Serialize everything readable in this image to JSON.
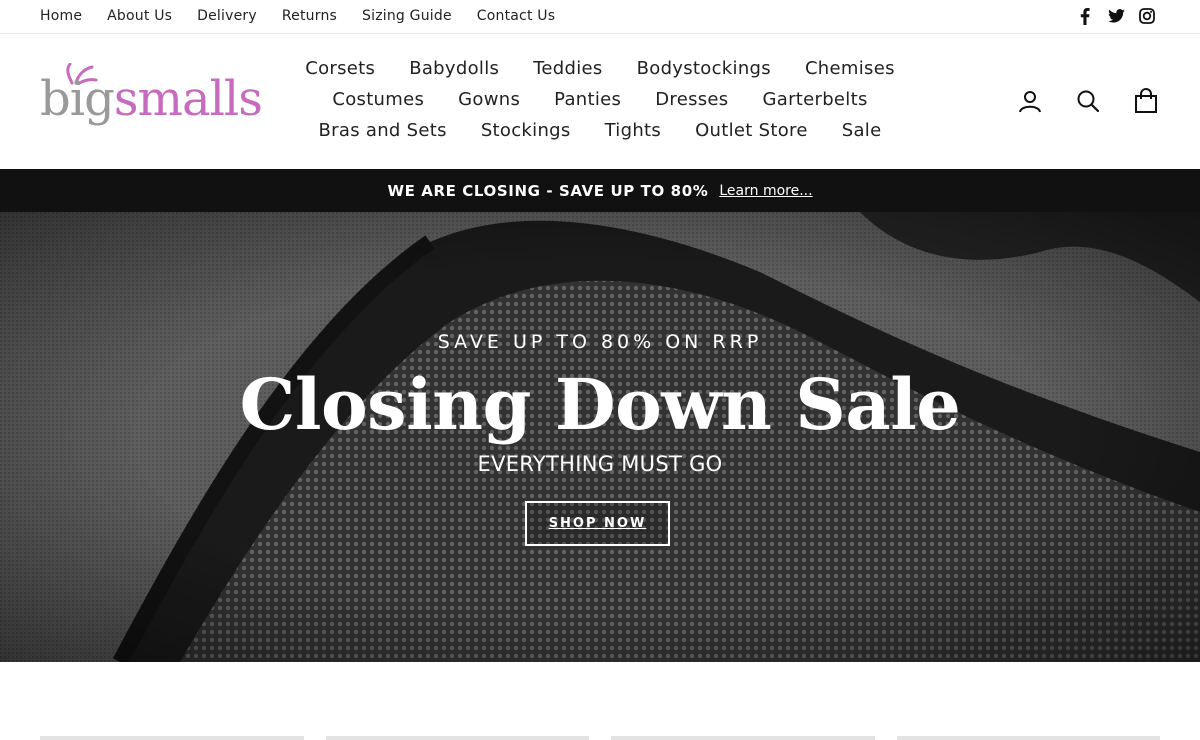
{
  "utility_nav": {
    "links": [
      "Home",
      "About Us",
      "Delivery",
      "Returns",
      "Sizing Guide",
      "Contact Us"
    ],
    "social_icons": [
      "facebook-icon",
      "twitter-icon",
      "instagram-icon"
    ]
  },
  "logo": {
    "part1": "big",
    "part2": "smalls",
    "accent_color": "#c76bbf",
    "base_color": "#9a9a9a"
  },
  "main_nav": {
    "items": [
      "Corsets",
      "Babydolls",
      "Teddies",
      "Bodystockings",
      "Chemises",
      "Costumes",
      "Gowns",
      "Panties",
      "Dresses",
      "Garterbelts",
      "Bras and Sets",
      "Stockings",
      "Tights",
      "Outlet Store",
      "Sale"
    ]
  },
  "header_icons": [
    "account-icon",
    "search-icon",
    "cart-icon"
  ],
  "announcement": {
    "message": "WE ARE CLOSING - SAVE UP TO 80%",
    "link": "Learn more..."
  },
  "hero": {
    "kicker": "SAVE UP TO 80% ON RRP",
    "title": "Closing Down Sale",
    "subtitle": "EVERYTHING MUST GO",
    "button": "SHOP NOW"
  }
}
